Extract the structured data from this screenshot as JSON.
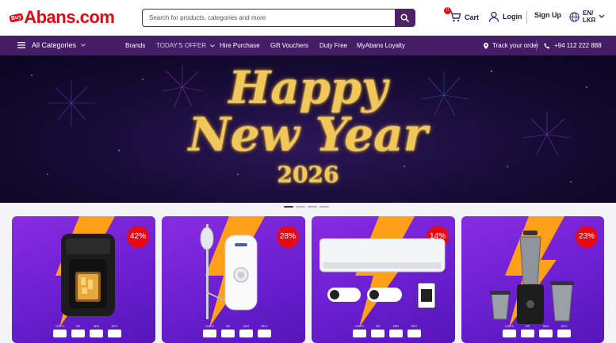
{
  "header": {
    "logo_badge": "Buy",
    "logo_text": "Abans.com",
    "search_placeholder": "Search for products, categories and more",
    "cart_label": "Cart",
    "cart_count": "0",
    "login_label": "Login",
    "signup_label": "Sign Up",
    "lang_line1": "EN/",
    "lang_line2": "LKR"
  },
  "nav": {
    "all_categories": "All Categories",
    "links": [
      "Brands",
      "TODAY'S OFFER",
      "Hire Purchase",
      "Gift Vouchers",
      "Duty Free",
      "MyAbans Loyalty"
    ],
    "track_order": "Track your order",
    "phone": "+94 112 222 888"
  },
  "banner": {
    "line1": "Happy",
    "line2": "New Year",
    "line3": "2026",
    "slides": 4,
    "active_slide": 0
  },
  "cards": [
    {
      "discount": "42%",
      "product_icon": "air-fryer"
    },
    {
      "discount": "28%",
      "product_icon": "water-heater"
    },
    {
      "discount": "14%",
      "product_icon": "air-conditioner"
    },
    {
      "discount": "23%",
      "product_icon": "mixer-grinder"
    }
  ],
  "timer_labels": [
    "DAYS",
    "HR",
    "MIN",
    "SEC"
  ],
  "colors": {
    "brand_purple": "#451d66",
    "brand_red": "#e30613",
    "card_purple": "#6a1fd0",
    "bolt_orange": "#ff9f1a",
    "banner_gold": "#f1c75b"
  }
}
